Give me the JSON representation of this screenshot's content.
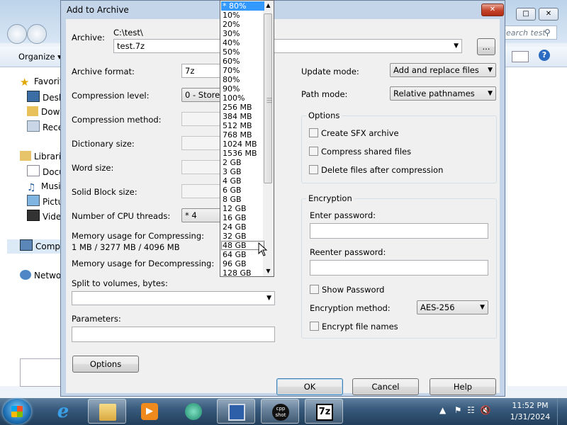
{
  "explorer": {
    "organize_label": "Organize ▾",
    "search_placeholder": "Search test",
    "nav_items": [
      {
        "label": "Favorites",
        "icon": "star-icon"
      },
      {
        "label": "Desktop",
        "icon": "desktop-icon"
      },
      {
        "label": "Downloads",
        "icon": "downloads-icon"
      },
      {
        "label": "Recent Places",
        "icon": "recent-icon"
      },
      {
        "label": "Libraries",
        "icon": "library-icon"
      },
      {
        "label": "Documents",
        "icon": "documents-icon"
      },
      {
        "label": "Music",
        "icon": "music-icon"
      },
      {
        "label": "Pictures",
        "icon": "pictures-icon"
      },
      {
        "label": "Videos",
        "icon": "videos-icon"
      },
      {
        "label": "Computer",
        "icon": "computer-icon"
      },
      {
        "label": "Network",
        "icon": "network-icon"
      }
    ]
  },
  "dialog": {
    "title": "Add to Archive",
    "archive_label": "Archive:",
    "archive_dir": "C:\\test\\",
    "archive_name": "test.7z",
    "browse_label": "...",
    "format_label": "Archive format:",
    "format_value": "7z",
    "level_label": "Compression level:",
    "level_value": "0 - Store",
    "method_label": "Compression method:",
    "dict_label": "Dictionary size:",
    "word_label": "Word size:",
    "solid_label": "Solid Block size:",
    "threads_label": "Number of CPU threads:",
    "threads_value": "* 4",
    "mem_comp_label": "Memory usage for Compressing:",
    "mem_comp_value": "1 MB / 3277 MB / 4096 MB",
    "mem_decomp_label": "Memory usage for Decompressing:",
    "split_label": "Split to volumes, bytes:",
    "params_label": "Parameters:",
    "options_button": "Options",
    "update_label": "Update mode:",
    "update_value": "Add and replace files",
    "path_label": "Path mode:",
    "path_value": "Relative pathnames",
    "options_group": "Options",
    "sfx_label": "Create SFX archive",
    "shared_label": "Compress shared files",
    "delete_label": "Delete files after compression",
    "encryption_group": "Encryption",
    "enter_pw_label": "Enter password:",
    "reenter_pw_label": "Reenter password:",
    "show_pw_label": "Show Password",
    "enc_method_label": "Encryption method:",
    "enc_method_value": "AES-256",
    "enc_names_label": "Encrypt file names",
    "ok_label": "OK",
    "cancel_label": "Cancel",
    "help_label": "Help"
  },
  "dropdown": {
    "items": [
      "* 80%",
      "10%",
      "20%",
      "30%",
      "40%",
      "50%",
      "60%",
      "70%",
      "80%",
      "90%",
      "100%",
      "256 MB",
      "384 MB",
      "512 MB",
      "768 MB",
      "1024 MB",
      "1536 MB",
      "2 GB",
      "3 GB",
      "4 GB",
      "6 GB",
      "8 GB",
      "12 GB",
      "16 GB",
      "24 GB",
      "32 GB",
      "48 GB",
      "64 GB",
      "96 GB",
      "128 GB"
    ],
    "selected_index": 0,
    "hover_index": 26
  },
  "taskbar": {
    "apps": [
      {
        "name": "internet-explorer",
        "label": "e"
      },
      {
        "name": "windows-explorer",
        "label": ""
      },
      {
        "name": "media-player",
        "label": ""
      },
      {
        "name": "app-green-circle",
        "label": ""
      },
      {
        "name": "remote-desktop",
        "label": ""
      },
      {
        "name": "cpp-shot",
        "label": "cpp shot"
      },
      {
        "name": "7zip",
        "label": "7z"
      }
    ],
    "time": "11:52 PM",
    "date": "1/31/2024"
  },
  "colors": {
    "selection": "#3399ff",
    "close_button": "#c4432a",
    "taskbar": "#2c4a69"
  }
}
